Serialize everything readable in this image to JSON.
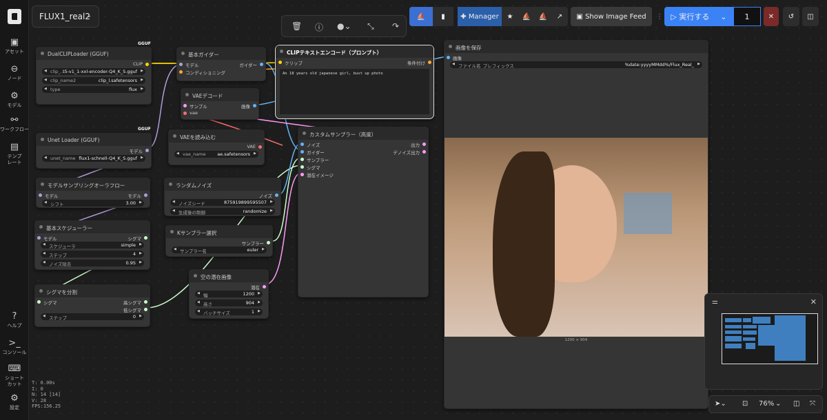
{
  "workflow": {
    "title": "FLUX1_real2"
  },
  "sidebar": {
    "items": [
      {
        "label": "アセット",
        "icon": "assets-icon"
      },
      {
        "label": "ノード",
        "icon": "node-icon"
      },
      {
        "label": "モデル",
        "icon": "model-icon"
      },
      {
        "label": "ワークフロー",
        "icon": "workflow-icon"
      },
      {
        "label": "テンプレート",
        "icon": "template-icon"
      },
      {
        "label": "ヘルプ",
        "icon": "help-icon"
      },
      {
        "label": "コンソール",
        "icon": "console-icon"
      },
      {
        "label": "ショートカット",
        "icon": "keyboard-icon"
      },
      {
        "label": "設定",
        "icon": "gear-icon"
      }
    ]
  },
  "stats": {
    "t": "T: 0.00s",
    "i": "I: 0",
    "n": "N: 14 [14]",
    "v": "V: 28",
    "fps": "FPS:156.25"
  },
  "topbar": {
    "manager": "Manager",
    "feed": "Show Image Feed",
    "run": "実行する",
    "batch": "1"
  },
  "zoom": "76%",
  "nodes": {
    "dualclip": {
      "title": "DualCLIPLoader (GGUF)",
      "badge": "GGUF",
      "out": "CLIP",
      "w1l": "clip_...",
      "w1v": "t5-v1_1-xxl-encoder-Q4_K_S.gguf",
      "w2l": "clip_name2",
      "w2v": "clip_l.safetensors",
      "w3l": "type",
      "w3v": "flux"
    },
    "guider": {
      "title": "基本ガイダー",
      "in1": "モデル",
      "in2": "コンディショニング",
      "out": "ガイダー"
    },
    "vaedecode": {
      "title": "VAEデコード",
      "in1": "サンプル",
      "in2": "vae",
      "out": "画像"
    },
    "clip": {
      "title": "CLIPテキストエンコード（プロンプト）",
      "in": "クリップ",
      "out": "条件付け",
      "text": "An 18 years old japanese girl, bust up photo"
    },
    "unet": {
      "title": "Unet Loader (GGUF)",
      "badge": "GGUF",
      "out": "モデル",
      "wl": "unet_name",
      "wv": "flux1-schnell-Q4_K_S.gguf"
    },
    "vaeload": {
      "title": "VAEを読み込む",
      "out": "VAE",
      "wl": "vae_name",
      "wv": "ae.safetensors"
    },
    "sampler": {
      "title": "カスタムサンプラー（高度）",
      "in1": "ノイズ",
      "in2": "ガイダー",
      "in3": "サンプラー",
      "in4": "シグマ",
      "in5": "潜在イメージ",
      "out1": "出力",
      "out2": "デノイズ出力"
    },
    "modelsampling": {
      "title": "モデルサンプリングオーラフロー",
      "in": "モデル",
      "out": "モデル",
      "wl": "シフト",
      "wv": "3.00"
    },
    "noise": {
      "title": "ランダムノイズ",
      "out": "ノイズ",
      "w1l": "ノイズシード",
      "w1v": "875919899595507",
      "w2l": "生成後の制御",
      "w2v": "randomize"
    },
    "scheduler": {
      "title": "基本スケジューラー",
      "in": "モデル",
      "out": "シグマ",
      "w1l": "スケジューラ",
      "w1v": "simple",
      "w2l": "ステップ",
      "w2v": "4",
      "w3l": "ノイズ除去",
      "w3v": "0.95"
    },
    "ksampler": {
      "title": "Kサンプラー選択",
      "out": "サンプラー",
      "wl": "サンプラー名",
      "wv": "euler"
    },
    "latent": {
      "title": "空の潜在画像",
      "out": "潜在",
      "w1l": "幅",
      "w1v": "1200",
      "w2l": "高さ",
      "w2v": "904",
      "w3l": "バッチサイズ",
      "w3v": "1"
    },
    "split": {
      "title": "シグマを分割",
      "in": "シグマ",
      "out1": "高シグマ",
      "out2": "低シグマ",
      "wl": "ステップ",
      "wv": "0"
    },
    "save": {
      "title": "画像を保存",
      "in": "画像",
      "wl": "ファイル名_プレフィックス",
      "wv": "%date:yyyyMMdd%/Flux_Real_",
      "dims": "1200 × 904"
    }
  },
  "colors": {
    "clip": "#ffd500",
    "model": "#b39ddb",
    "vae": "#ff6e6e",
    "latent": "#ff9cf9",
    "image": "#64b5f6",
    "cond": "#ffa931",
    "sigma": "#cdffcd",
    "accent": "#3b82f6"
  }
}
